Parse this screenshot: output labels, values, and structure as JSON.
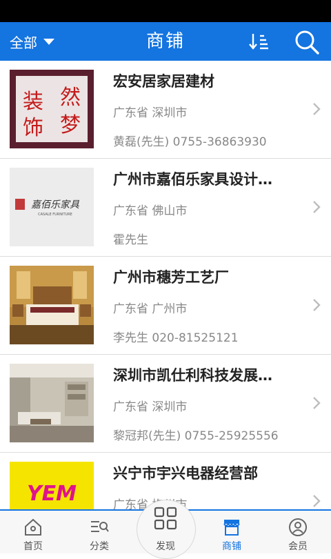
{
  "header": {
    "filter_label": "全部",
    "title": "商铺",
    "sort_icon": "sort-icon",
    "search_icon": "search-icon",
    "background": "#1474e0"
  },
  "shops": [
    {
      "name": "宏安居家居建材",
      "location": "广东省 深圳市",
      "contact": "黄磊(先生) 0755-36863930",
      "image_text": [
        "装",
        "然",
        "饰",
        "梦"
      ]
    },
    {
      "name": "广州市嘉佰乐家具设计…",
      "location": "广东省 佛山市",
      "contact": "霍先生",
      "image_text": [
        "嘉佰乐家具",
        "CASALE FURNITURE"
      ]
    },
    {
      "name": "广州市穗芳工艺厂",
      "location": "广东省 广州市",
      "contact": "李先生 020-81525121"
    },
    {
      "name": "深圳市凯仕利科技发展…",
      "location": "广东省 深圳市",
      "contact": "黎冠邦(先生) 0755-25925556"
    },
    {
      "name": "兴宁市宇兴电器经营部",
      "location": "广东省 梅州市",
      "contact": "",
      "image_text": [
        "YEM"
      ]
    }
  ],
  "bottom_nav": [
    {
      "label": "首页",
      "icon": "home-icon"
    },
    {
      "label": "分类",
      "icon": "category-icon"
    },
    {
      "label": "发现",
      "icon": "discover-grid-icon"
    },
    {
      "label": "商铺",
      "icon": "shop-icon",
      "active": true
    },
    {
      "label": "会员",
      "icon": "member-icon"
    }
  ],
  "accent_color": "#1474e0"
}
